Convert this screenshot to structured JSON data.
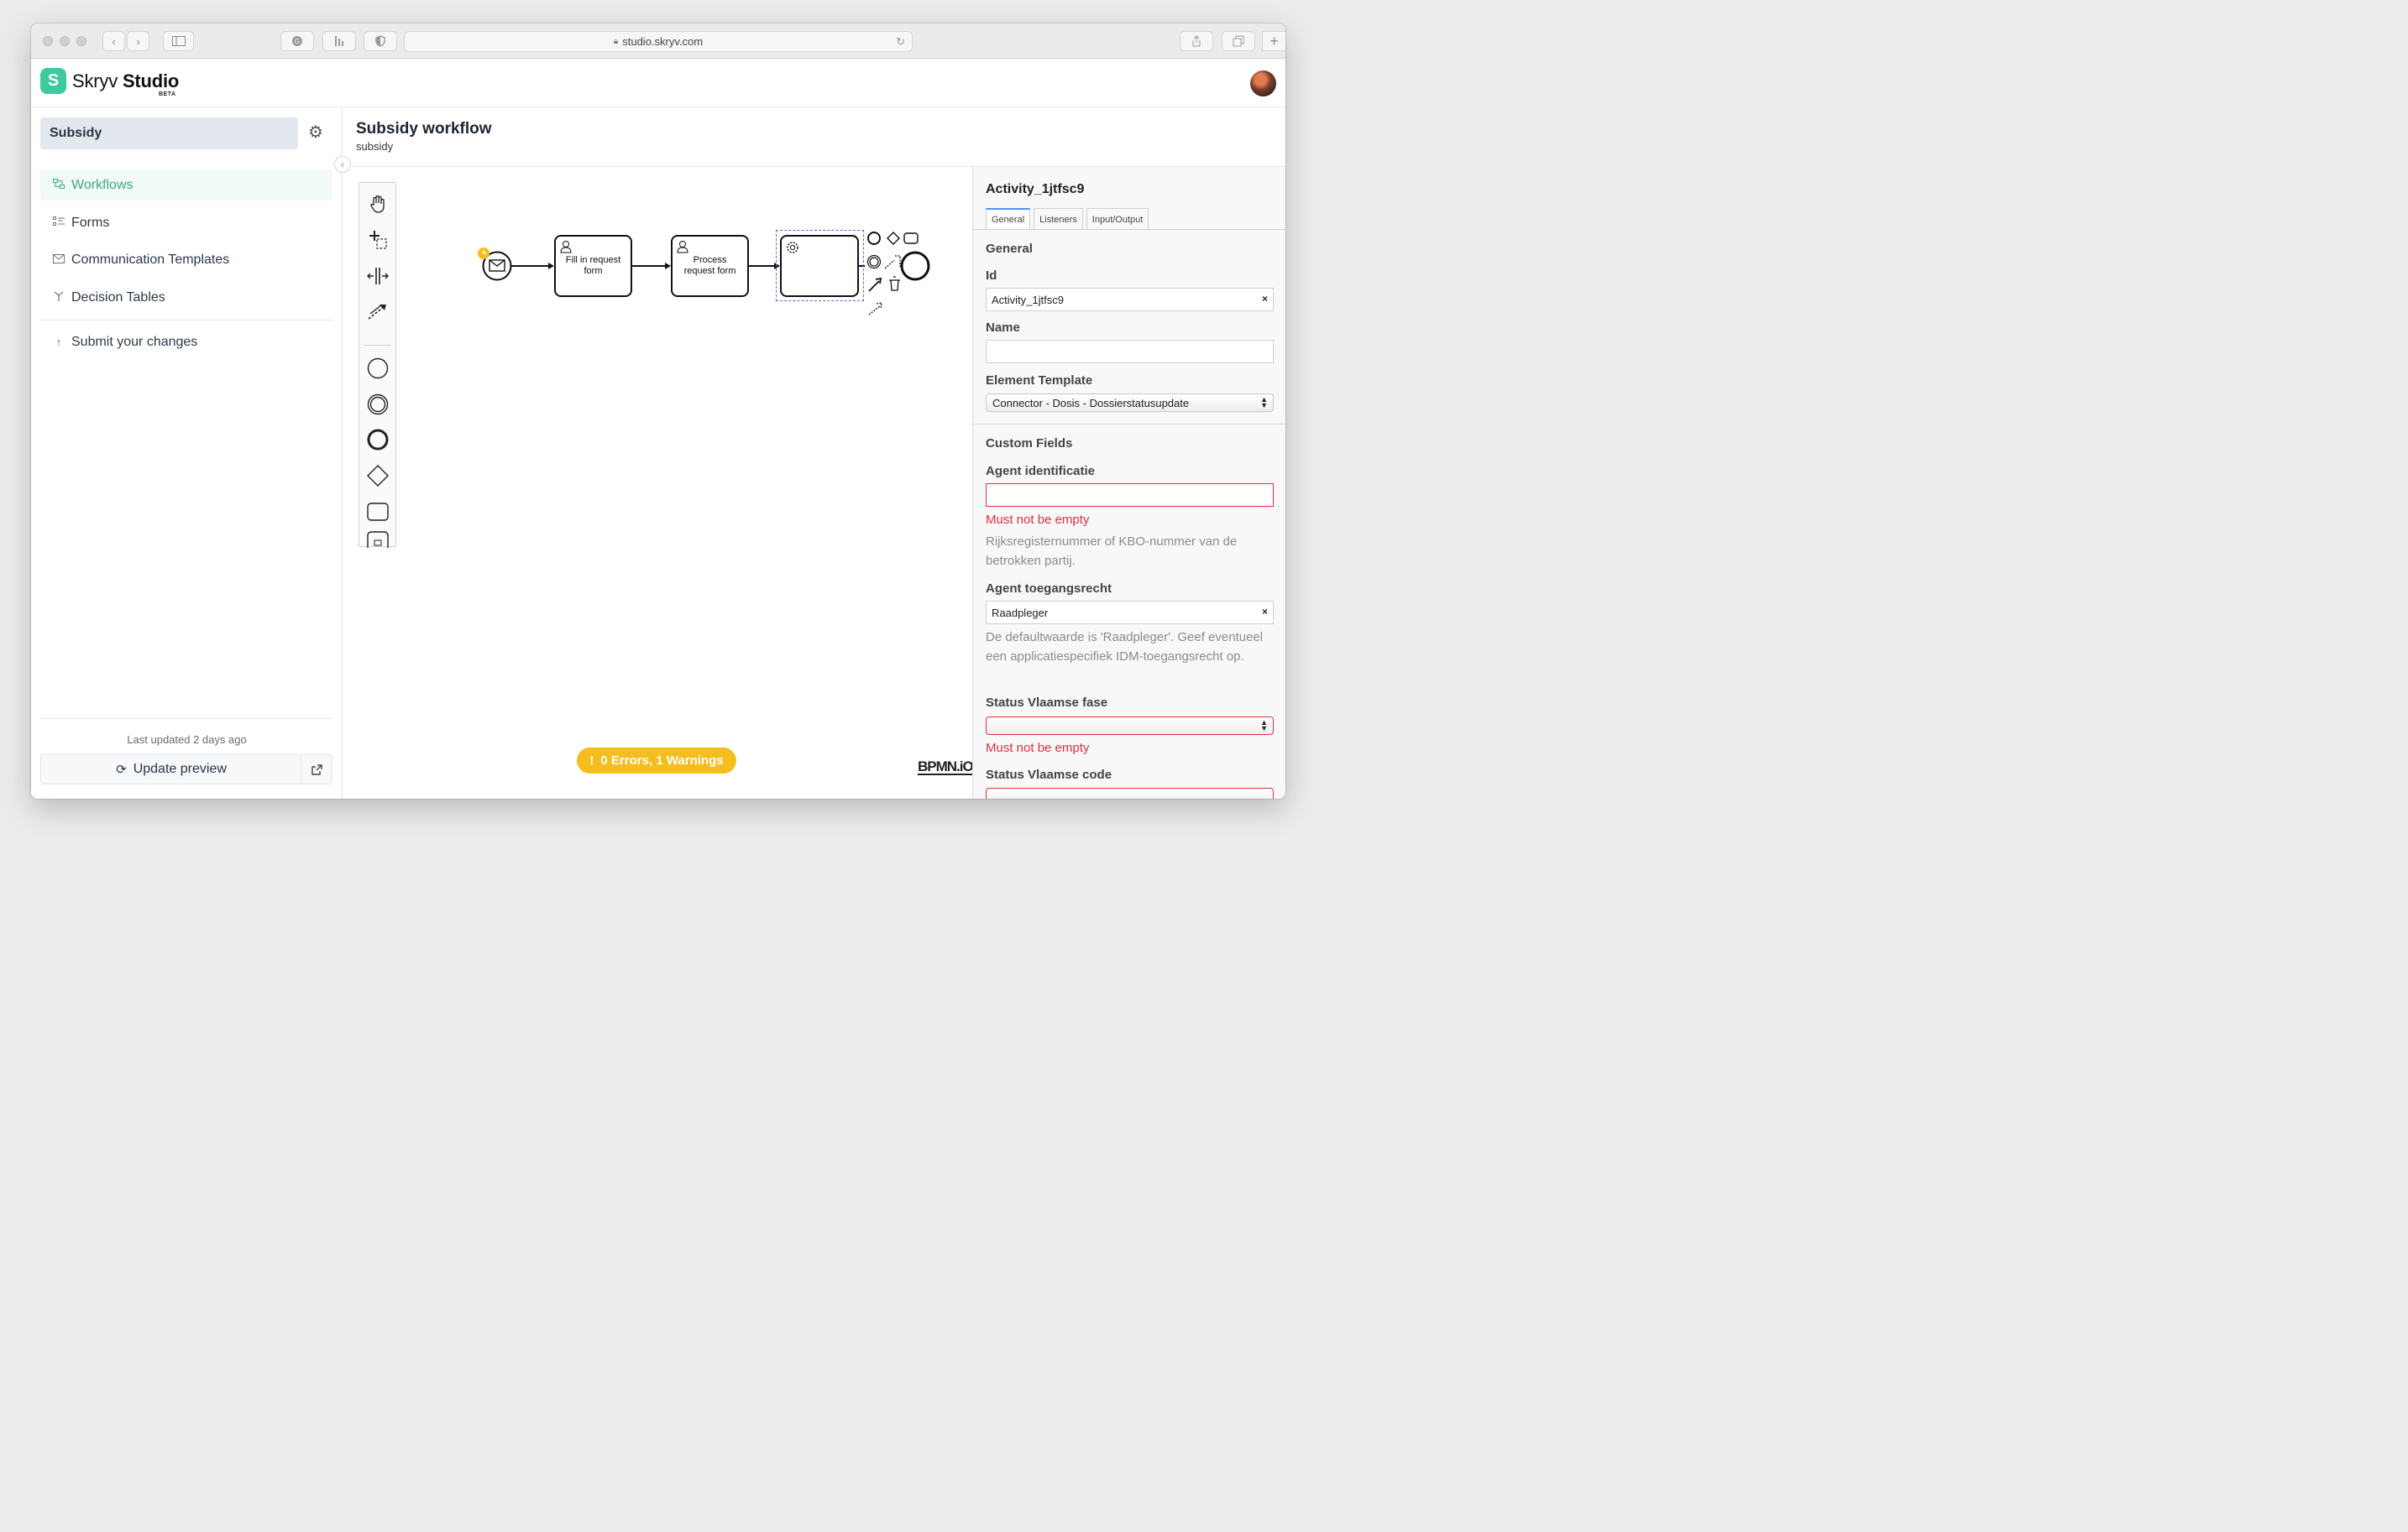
{
  "browser": {
    "url": "studio.skryv.com"
  },
  "header": {
    "logo_letter": "S",
    "brand_first": "Skryv",
    "brand_second": "Studio",
    "beta": "BETA"
  },
  "sidebar": {
    "project": "Subsidy",
    "items": [
      {
        "label": "Workflows",
        "icon": "workflow-icon",
        "active": true
      },
      {
        "label": "Forms",
        "icon": "form-list-icon",
        "active": false
      },
      {
        "label": "Communication Templates",
        "icon": "envelope-icon",
        "active": false
      },
      {
        "label": "Decision Tables",
        "icon": "decision-icon",
        "active": false
      }
    ],
    "submit": "Submit your changes",
    "last_updated": "Last updated 2 days ago",
    "update_preview": "Update preview"
  },
  "main": {
    "title": "Subsidy workflow",
    "subtitle": "subsidy"
  },
  "diagram": {
    "tasks": [
      {
        "label": "Fill in request form"
      },
      {
        "label": "Process request form"
      },
      {
        "label": ""
      }
    ],
    "status": "0 Errors, 1 Warnings",
    "watermark": "BPMN.iO"
  },
  "properties": {
    "element_id": "Activity_1jtfsc9",
    "tabs": [
      "General",
      "Listeners",
      "Input/Output"
    ],
    "section_general": "General",
    "id_label": "Id",
    "id_value": "Activity_1jtfsc9",
    "name_label": "Name",
    "name_value": "",
    "template_label": "Element Template",
    "template_value": "Connector - Dosis - Dossierstatusupdate",
    "section_custom": "Custom Fields",
    "agent_id_label": "Agent identificatie",
    "agent_id_error": "Must not be empty",
    "agent_id_help": "Rijksregisternummer of KBO-nummer van de betrokken partij.",
    "agent_right_label": "Agent toegangsrecht",
    "agent_right_value": "Raadpleger",
    "agent_right_help": "De defaultwaarde is 'Raadpleger'. Geef eventueel een applicatiespecifiek IDM-toegangsrecht op.",
    "status_phase_label": "Status Vlaamse fase",
    "status_phase_error": "Must not be empty",
    "status_code_label": "Status Vlaamse code"
  },
  "colors": {
    "accent": "#3ec9a0",
    "error": "#e0303a",
    "warning": "#f5be1e"
  }
}
